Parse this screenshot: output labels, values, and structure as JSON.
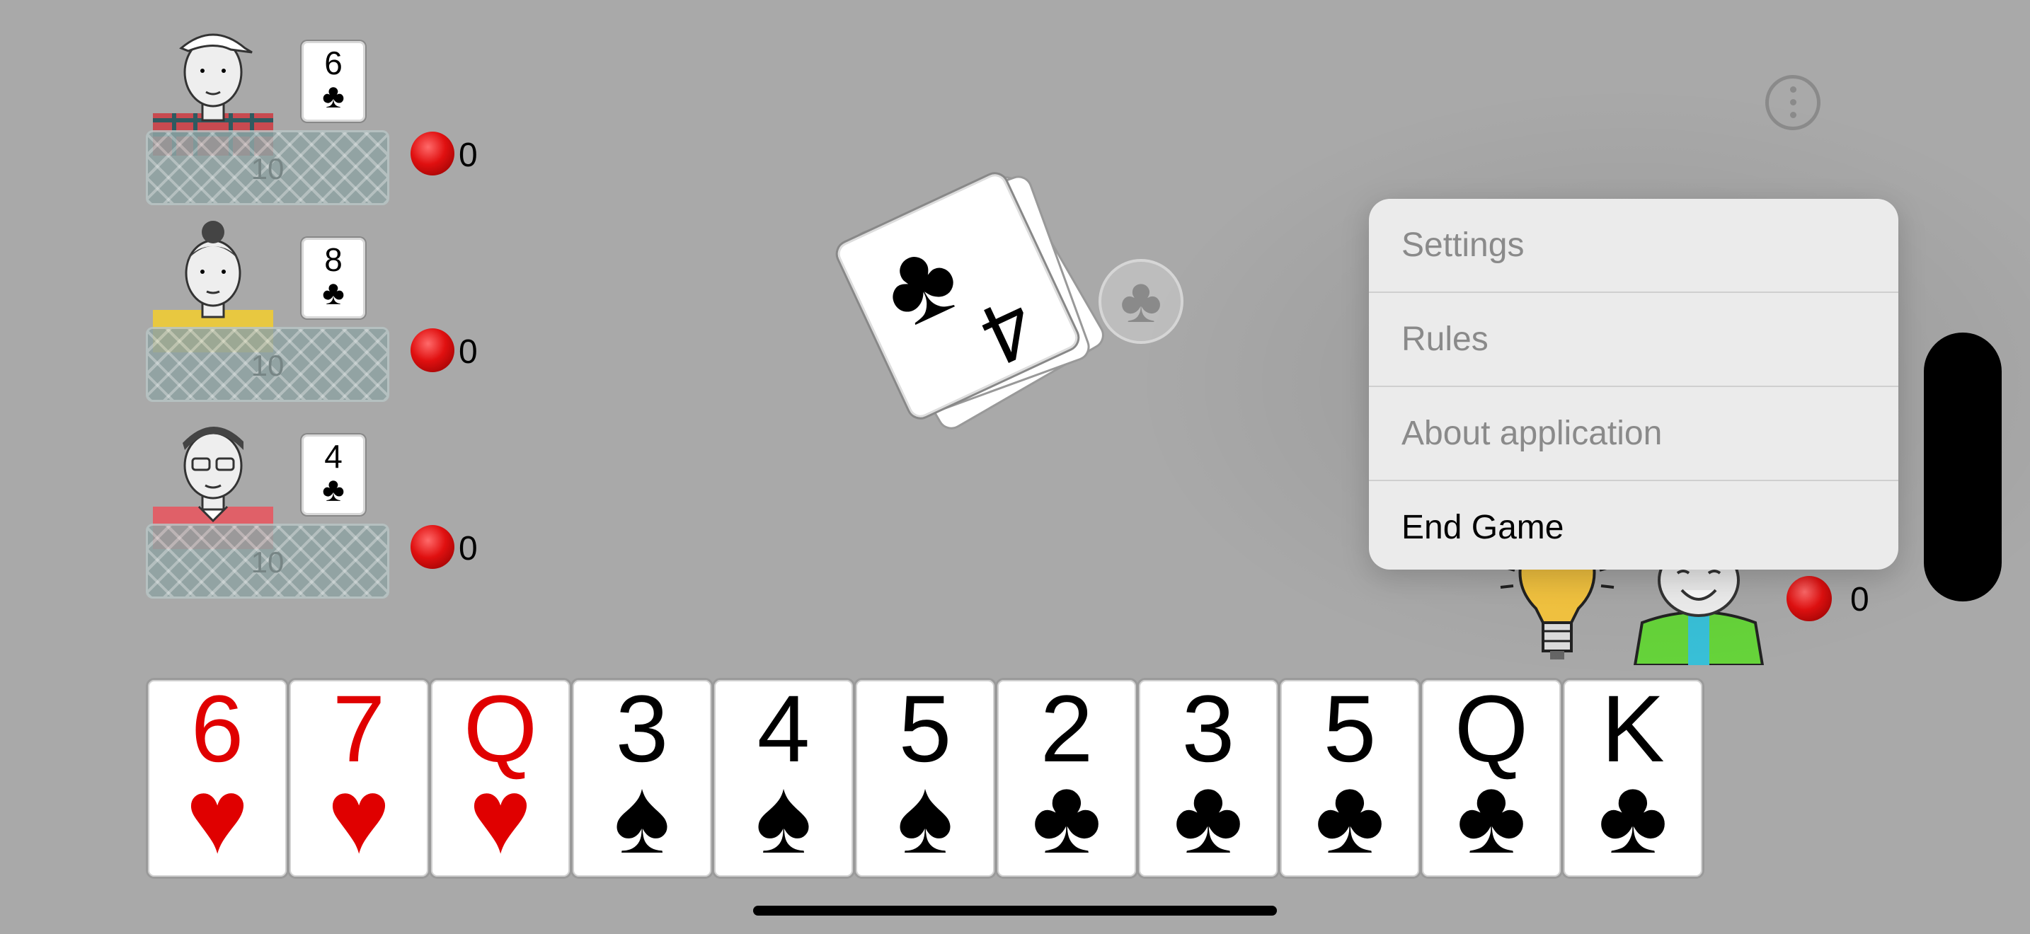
{
  "opponents": [
    {
      "card": {
        "rank": "6",
        "suit": "♣"
      },
      "hand_count": "10",
      "score": "0"
    },
    {
      "card": {
        "rank": "8",
        "suit": "♣"
      },
      "hand_count": "10",
      "score": "0"
    },
    {
      "card": {
        "rank": "4",
        "suit": "♣"
      },
      "hand_count": "10",
      "score": "0"
    }
  ],
  "table": {
    "top_card": {
      "rank": "4",
      "suit": "♣"
    },
    "current_suit": "♣"
  },
  "player": {
    "score": "0"
  },
  "hand": [
    {
      "rank": "6",
      "suit": "♥",
      "color": "red"
    },
    {
      "rank": "7",
      "suit": "♥",
      "color": "red"
    },
    {
      "rank": "Q",
      "suit": "♥",
      "color": "red"
    },
    {
      "rank": "3",
      "suit": "♠",
      "color": "black"
    },
    {
      "rank": "4",
      "suit": "♠",
      "color": "black"
    },
    {
      "rank": "5",
      "suit": "♠",
      "color": "black"
    },
    {
      "rank": "2",
      "suit": "♣",
      "color": "black"
    },
    {
      "rank": "3",
      "suit": "♣",
      "color": "black"
    },
    {
      "rank": "5",
      "suit": "♣",
      "color": "black"
    },
    {
      "rank": "Q",
      "suit": "♣",
      "color": "black"
    },
    {
      "rank": "K",
      "suit": "♣",
      "color": "black"
    }
  ],
  "menu": {
    "items": [
      "Settings",
      "Rules",
      "About application",
      "End Game"
    ]
  },
  "colors": {
    "background": "#a9a9a9",
    "red_suit": "#e00000",
    "chip": "#e01010",
    "menu_bg": "#ebebeb"
  }
}
